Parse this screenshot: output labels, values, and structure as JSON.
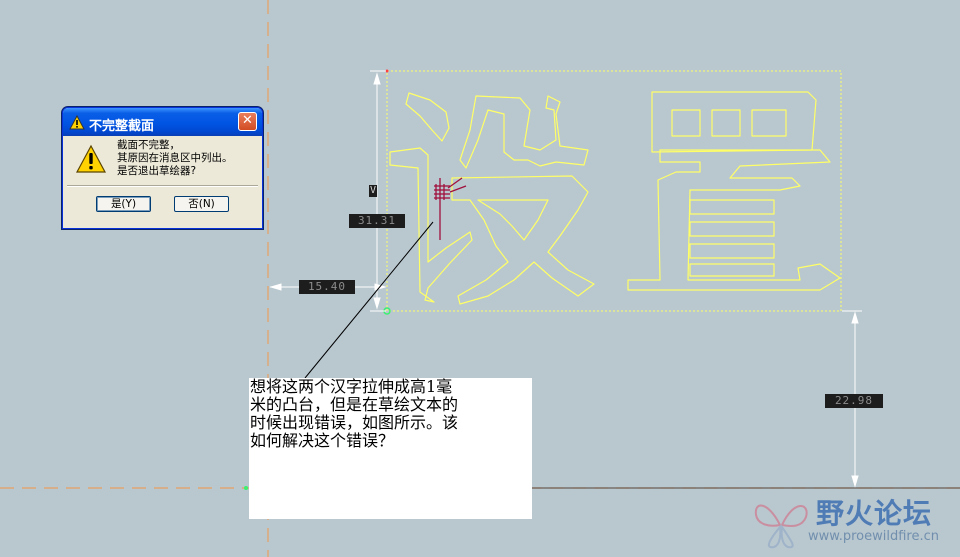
{
  "sketch": {
    "dimensions": {
      "height": "31.31",
      "left_offset": "15.40",
      "bottom_offset": "22.98"
    },
    "vertical_marker": "V"
  },
  "dialog": {
    "title": "不完整截面",
    "message_lines": [
      "截面不完整，",
      "其原因在消息区中列出。",
      "是否退出草绘器?"
    ],
    "yes_label": "是(Y)",
    "no_label": "否(N)",
    "close_glyph": "✕"
  },
  "annotation": {
    "lines": [
      "想将这两个汉字拉伸成高1毫",
      "米的凸台，但是在草绘文本的",
      "时候出现错误，如图所示。该",
      "如何解决这个错误？"
    ]
  },
  "watermark": {
    "name": "野火论坛",
    "url": "www.proewildfire.cn"
  },
  "colors": {
    "background": "#b9c7cf",
    "sketch_geometry": "#ffff66",
    "axis_dash": "#e8a060",
    "dimension_lines": "#ffffff",
    "dialog_title_bar": "#0054e3"
  }
}
